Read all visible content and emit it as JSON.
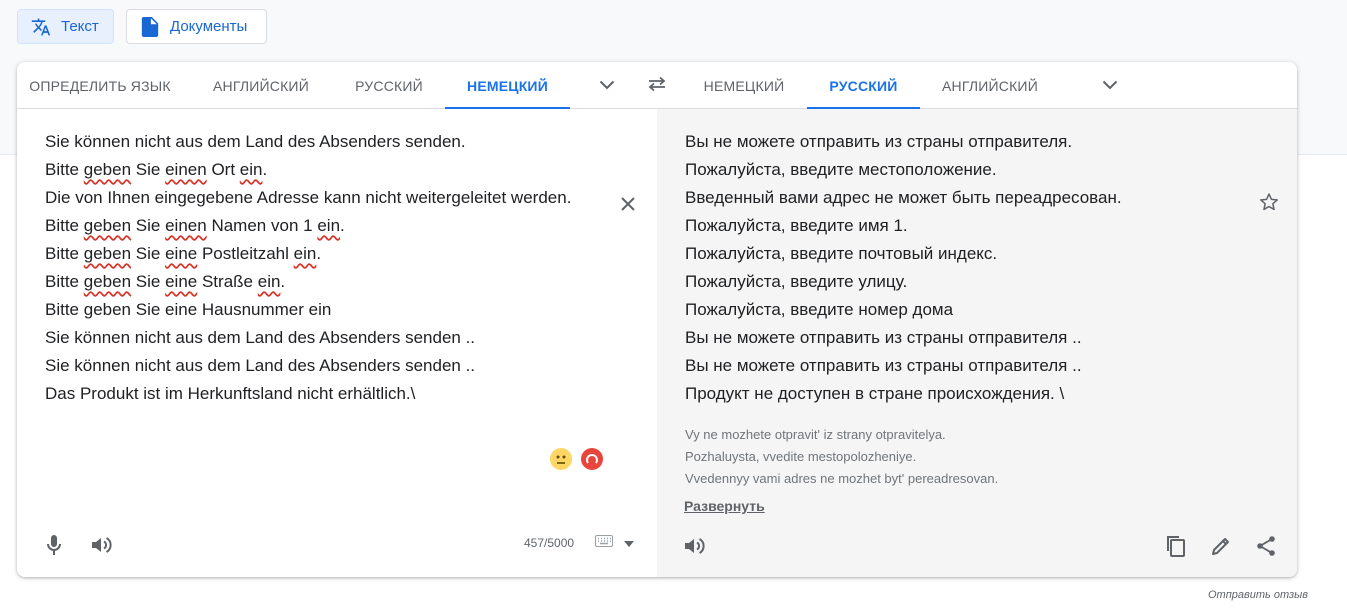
{
  "mode_buttons": {
    "text": "Текст",
    "documents": "Документы"
  },
  "source_langs": [
    "ОПРЕДЕЛИТЬ ЯЗЫК",
    "АНГЛИЙСКИЙ",
    "РУССКИЙ",
    "НЕМЕЦКИЙ"
  ],
  "target_langs": [
    "НЕМЕЦКИЙ",
    "РУССКИЙ",
    "АНГЛИЙСКИЙ"
  ],
  "active_source_lang": "НЕМЕЦКИЙ",
  "active_target_lang": "РУССКИЙ",
  "source_lines": [
    "Sie können nicht aus dem Land des Absenders senden.",
    "Bitte geben Sie einen Ort ein.",
    "Die von Ihnen eingegebene Adresse kann nicht weitergeleitet werden.",
    "Bitte geben Sie einen Namen von 1 ein.",
    "Bitte geben Sie eine Postleitzahl ein.",
    "Bitte geben Sie eine Straße ein.",
    "Bitte geben Sie eine Hausnummer ein",
    "Sie können nicht aus dem Land des Absenders senden ..",
    "Sie können nicht aus dem Land des Absenders senden ..",
    "Das Produkt ist im Herkunftsland nicht erhältlich.\\"
  ],
  "target_lines": [
    "Вы не можете отправить из страны отправителя.",
    "Пожалуйста, введите местоположение.",
    "Введенный вами адрес не может быть переадресован.",
    "Пожалуйста, введите имя 1.",
    "Пожалуйста, введите почтовый индекс.",
    "Пожалуйста, введите улицу.",
    "Пожалуйста, введите номер дома",
    "Вы не можете отправить из страны отправителя ..",
    "Вы не можете отправить из страны отправителя ..",
    "Продукт не доступен в стране происхождения. \\"
  ],
  "transliteration": [
    "Vy ne mozhete otpravit' iz strany otpravitelya.",
    "Pozhaluysta, vvedite mestopolozheniye.",
    "Vvedennyy vami adres ne mozhet byt' pereadresovan."
  ],
  "expand_label": "Развернуть",
  "char_count": "457/5000",
  "feedback_label": "Отправить отзыв",
  "colors": {
    "accent": "#1a73e8",
    "spellcheck": "#d93025"
  }
}
